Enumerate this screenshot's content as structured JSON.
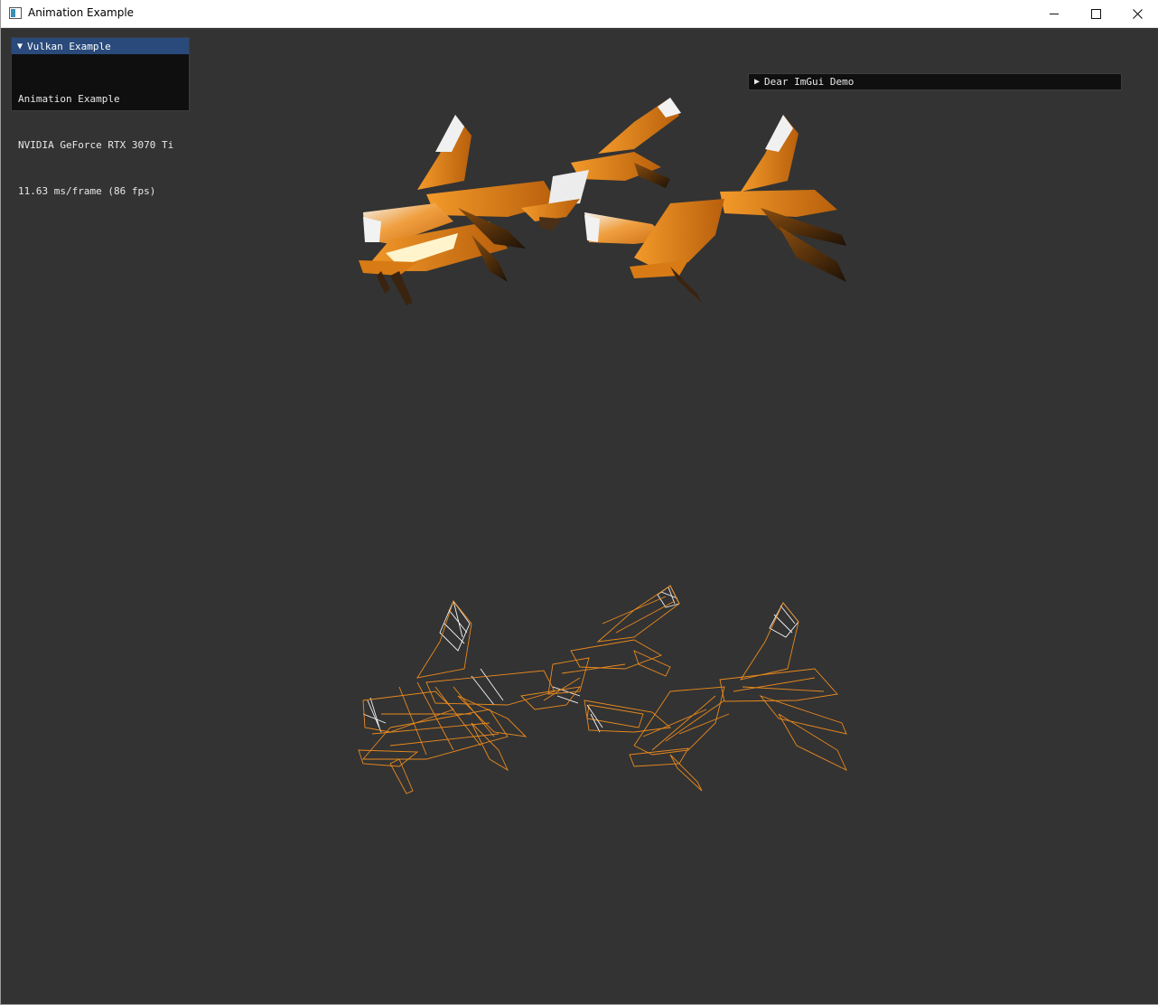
{
  "window": {
    "title": "Animation Example",
    "icon": "app-window-icon",
    "controls": [
      "minimize-icon",
      "maximize-icon",
      "close-icon"
    ]
  },
  "overlay": {
    "header": "Vulkan Example",
    "lines": [
      "Animation Example",
      "NVIDIA GeForce RTX 3070 Ti",
      "11.63 ms/frame (86 fps)"
    ],
    "collapse_icon": "triangle-down-icon"
  },
  "demo_window": {
    "label": "Dear ImGui Demo",
    "expand_icon": "triangle-right-icon"
  },
  "colors": {
    "background": "#333333",
    "model_orange": "#e8891e",
    "model_white": "#f2f2f2",
    "model_shadow": "#2a1a08",
    "imgui_header": "#294a7a",
    "imgui_bg": "#0f0f0f"
  }
}
